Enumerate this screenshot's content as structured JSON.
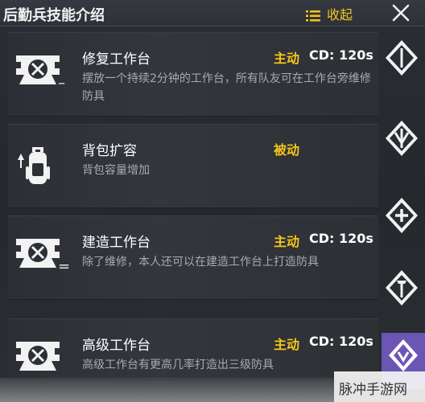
{
  "header": {
    "title": "后勤兵技能介绍",
    "collapse_label": "收起",
    "accent": "#f5c518"
  },
  "skills": [
    {
      "name": "修复工作台",
      "type": "主动",
      "cd": "CD: 120s",
      "desc": "摆放一个持续2分钟的工作台，所有队友可在工作台旁维修防具",
      "icon": "workbench-icon",
      "level_mark": "–"
    },
    {
      "name": "背包扩容",
      "type": "被动",
      "cd": "",
      "desc": "背包容量增加",
      "icon": "backpack-icon",
      "level_mark": ""
    },
    {
      "name": "建造工作台",
      "type": "主动",
      "cd": "CD: 120s",
      "desc": "除了维修，本人还可以在建造工作台上打造防具",
      "icon": "workbench-icon",
      "level_mark": "="
    },
    {
      "name": "高级工作台",
      "type": "主动",
      "cd": "CD: 120s",
      "desc": "高级工作台有更高几率打造出三级防具",
      "icon": "workbench-icon",
      "level_mark": "≡"
    }
  ],
  "sidebar": [
    "rank-1-icon",
    "rank-2-icon",
    "plus-icon",
    "rank-3-icon",
    "rank-4-icon"
  ],
  "watermark": {
    "text": "脉冲手游网"
  }
}
